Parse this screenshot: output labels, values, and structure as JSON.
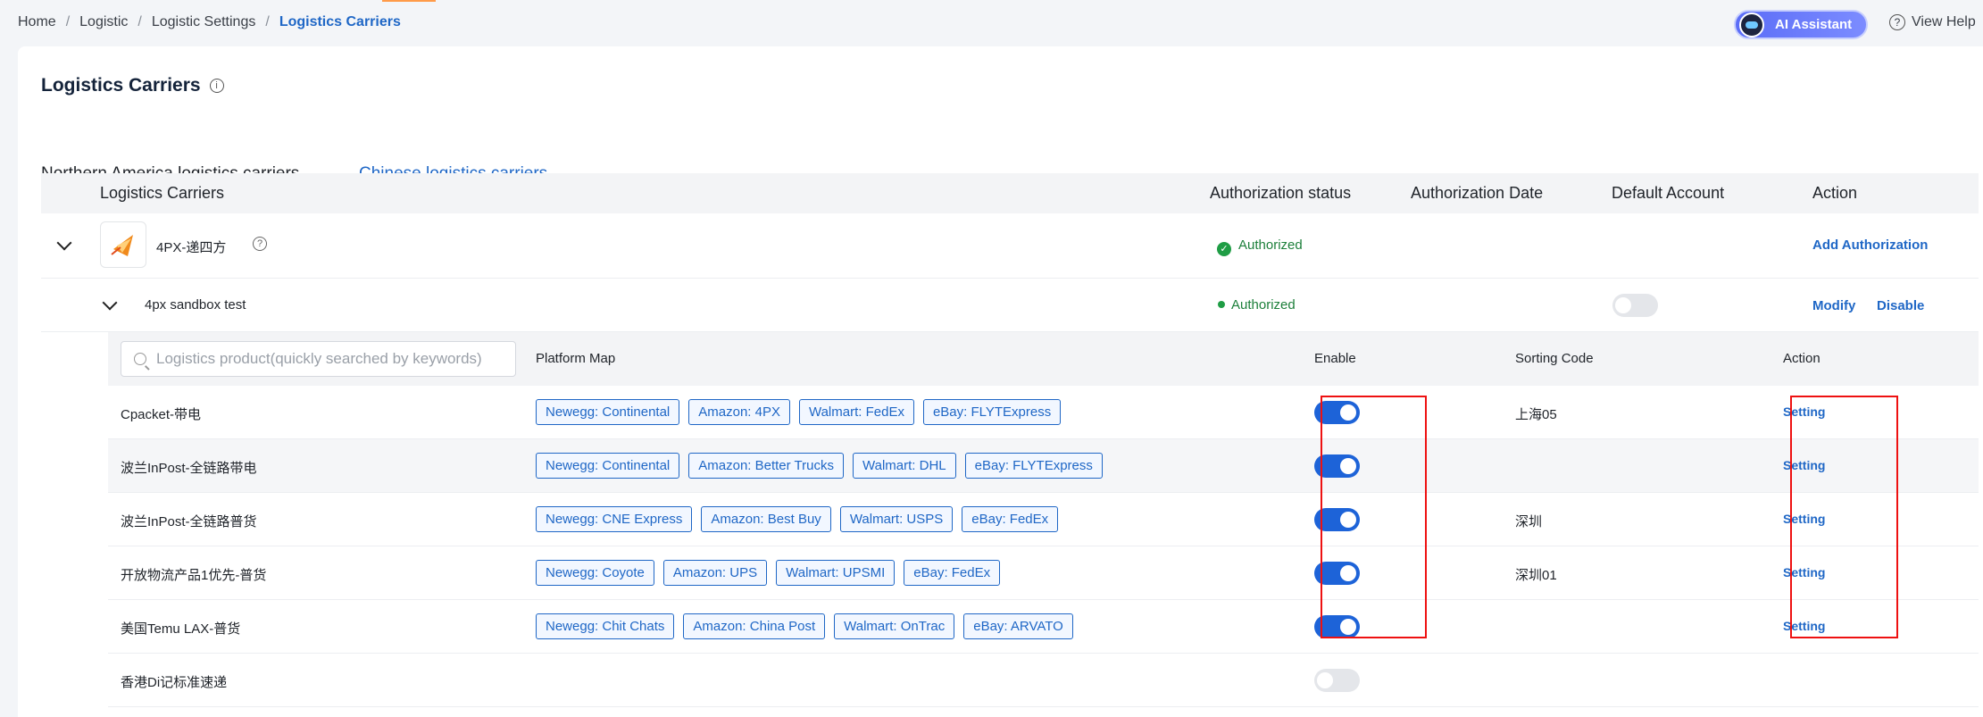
{
  "breadcrumb": {
    "items": [
      "Home",
      "Logistic",
      "Logistic Settings"
    ],
    "current": "Logistics Carriers"
  },
  "ai_assistant": {
    "label": "AI Assistant"
  },
  "help": {
    "label": "View Help"
  },
  "page": {
    "title": "Logistics Carriers"
  },
  "tabs": [
    {
      "label": "Northern America logistics carriers",
      "active": false
    },
    {
      "label": "Chinese logistics carriers",
      "active": true
    }
  ],
  "table": {
    "headers": {
      "carriers": "Logistics Carriers",
      "auth_status": "Authorization status",
      "auth_date": "Authorization Date",
      "default_account": "Default Account",
      "action": "Action"
    },
    "carrier": {
      "name": "4PX-递四方",
      "status": "Authorized",
      "action": "Add Authorization"
    },
    "account": {
      "name": "4px sandbox test",
      "status": "Authorized",
      "default_enabled": false,
      "modify": "Modify",
      "disable": "Disable"
    }
  },
  "products": {
    "search_placeholder": "Logistics product(quickly searched by keywords)",
    "headers": {
      "platform_map": "Platform Map",
      "enable": "Enable",
      "sorting_code": "Sorting Code",
      "action": "Action"
    },
    "rows": [
      {
        "name": "Cpacket-带电",
        "tags": [
          "Newegg: Continental",
          "Amazon: 4PX",
          "Walmart: FedEx",
          "eBay: FLYTExpress"
        ],
        "enabled": true,
        "sorting_code": "上海05",
        "action": "Setting"
      },
      {
        "name": "波兰InPost-全链路带电",
        "tags": [
          "Newegg: Continental",
          "Amazon: Better Trucks",
          "Walmart: DHL",
          "eBay: FLYTExpress"
        ],
        "enabled": true,
        "sorting_code": "",
        "action": "Setting"
      },
      {
        "name": "波兰InPost-全链路普货",
        "tags": [
          "Newegg: CNE Express",
          "Amazon: Best Buy",
          "Walmart: USPS",
          "eBay: FedEx"
        ],
        "enabled": true,
        "sorting_code": "深圳",
        "action": "Setting"
      },
      {
        "name": "开放物流产品1优先-普货",
        "tags": [
          "Newegg: Coyote",
          "Amazon: UPS",
          "Walmart: UPSMI",
          "eBay: FedEx"
        ],
        "enabled": true,
        "sorting_code": "深圳01",
        "action": "Setting"
      },
      {
        "name": "美国Temu LAX-普货",
        "tags": [
          "Newegg: Chit Chats",
          "Amazon: China Post",
          "Walmart: OnTrac",
          "eBay: ARVATO"
        ],
        "enabled": true,
        "sorting_code": "",
        "action": "Setting"
      },
      {
        "name": "香港Di记标准速递",
        "tags": [],
        "enabled": false,
        "sorting_code": "",
        "action": ""
      }
    ]
  },
  "colors": {
    "accent": "#1f67c6",
    "toggle_on": "#1d63d8",
    "authorized": "#1f9d45",
    "highlight": "#ee1111"
  }
}
